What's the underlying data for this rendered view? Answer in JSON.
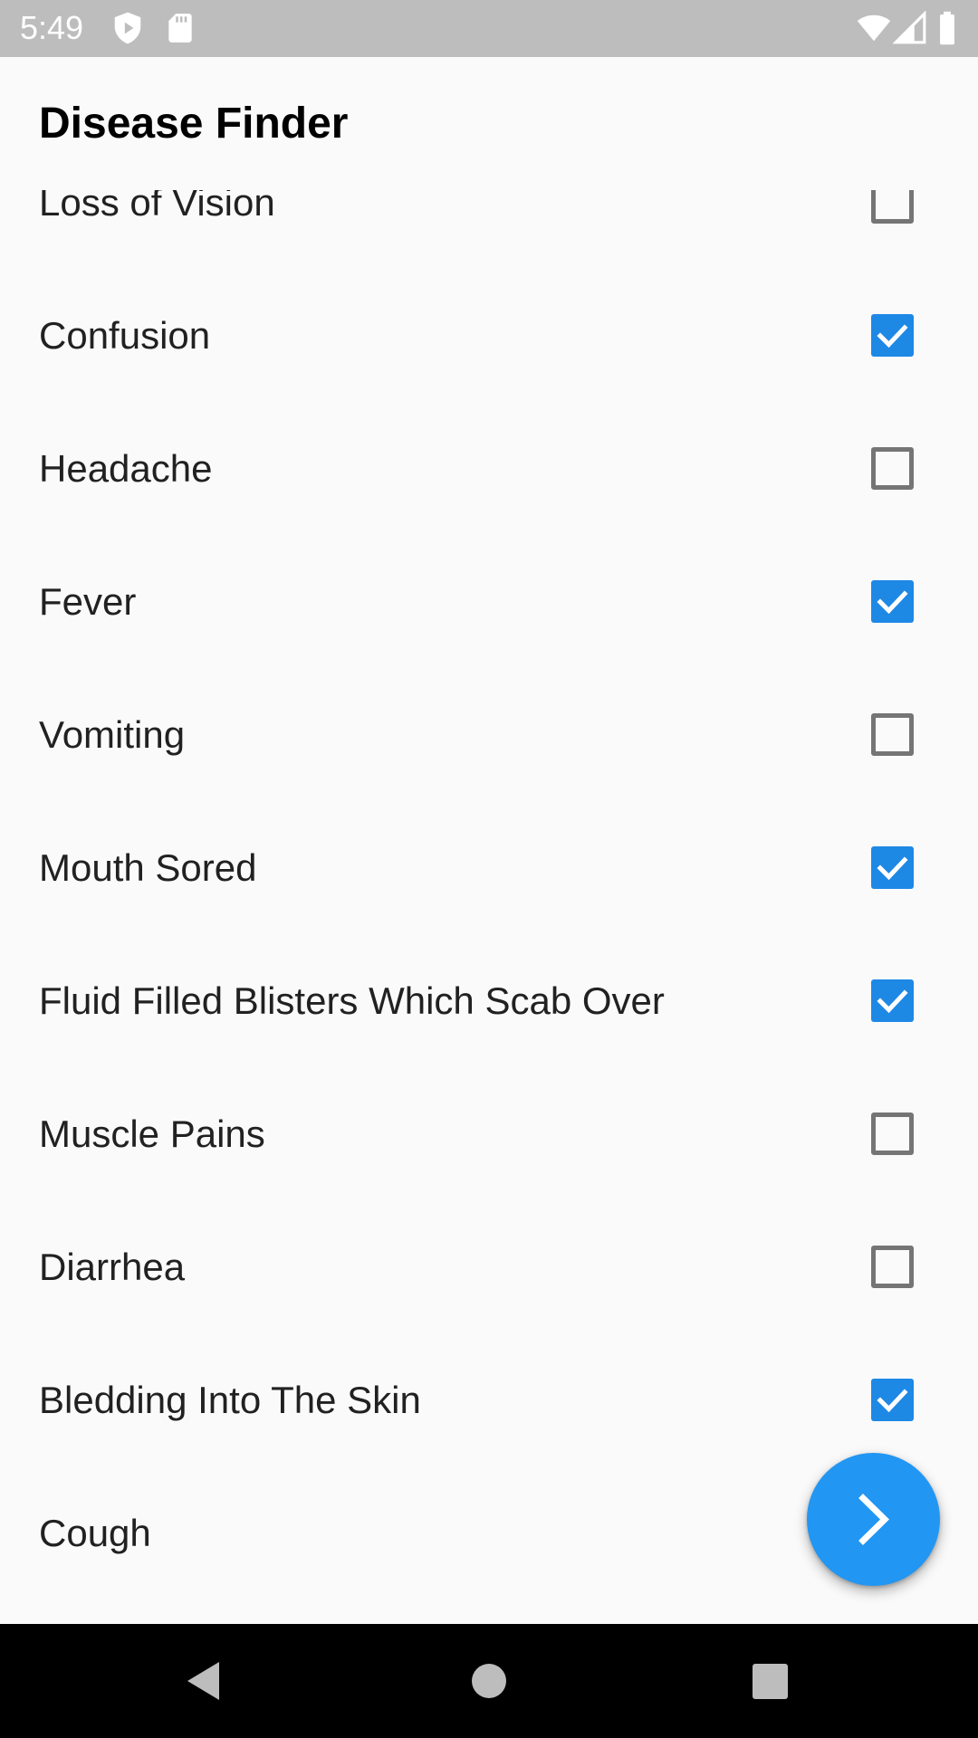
{
  "status_bar": {
    "time": "5:49",
    "icons": [
      "play-protect-icon",
      "sd-card-icon",
      "wifi-icon",
      "signal-icon",
      "battery-icon"
    ]
  },
  "app_bar": {
    "title": "Disease Finder"
  },
  "symptoms": [
    {
      "label": "Loss of Vision",
      "checked": false
    },
    {
      "label": "Confusion",
      "checked": true
    },
    {
      "label": "Headache",
      "checked": false
    },
    {
      "label": "Fever",
      "checked": true
    },
    {
      "label": "Vomiting",
      "checked": false
    },
    {
      "label": "Mouth Sored",
      "checked": true
    },
    {
      "label": "Fluid Filled Blisters Which Scab Over",
      "checked": true
    },
    {
      "label": "Muscle Pains",
      "checked": false
    },
    {
      "label": "Diarrhea",
      "checked": false
    },
    {
      "label": "Bledding Into The Skin",
      "checked": true
    },
    {
      "label": "Cough",
      "checked": false
    }
  ],
  "fab": {
    "icon": "chevron-right-icon"
  },
  "nav_bar": {
    "icons": [
      "back-icon",
      "home-icon",
      "recents-icon"
    ]
  },
  "colors": {
    "accent": "#2196f3",
    "checkbox_checked": "#1e88e5",
    "checkbox_unchecked": "#757575",
    "status_bar": "#bdbdbd",
    "background": "#fafafa",
    "text": "#212121"
  }
}
